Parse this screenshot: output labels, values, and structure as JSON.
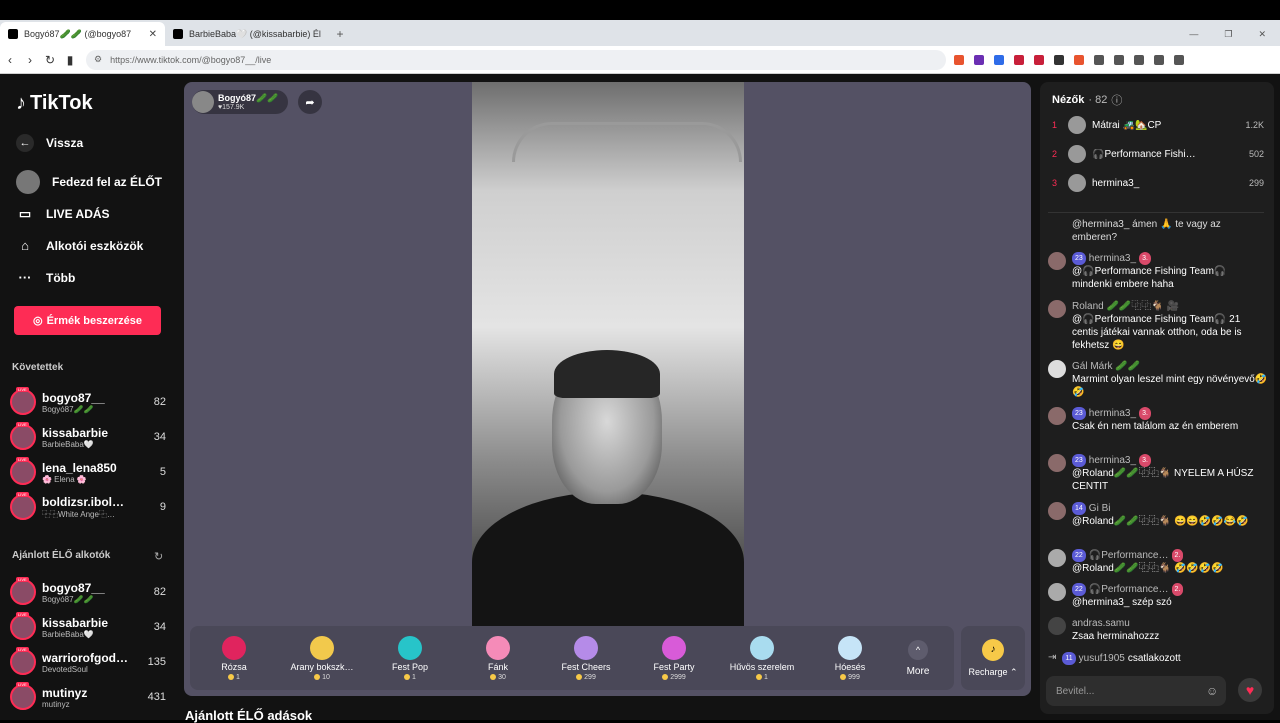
{
  "browser": {
    "tabs": [
      {
        "title": "Bogyó87🥒🥒 (@bogyo87",
        "close": "✕"
      },
      {
        "title": "BarbieBaba🤍 (@kissabarbie) Él…",
        "close": ""
      }
    ],
    "new_tab": "+",
    "url": "https://www.tiktok.com/@bogyo87__/live"
  },
  "sidebar": {
    "logo": "TikTok",
    "nav": [
      {
        "label": "Vissza",
        "icon": "back-arrow-icon"
      },
      {
        "label": "Fedezd fel az ÉLŐT",
        "icon": "avatar"
      },
      {
        "label": "LIVE ADÁS",
        "icon": "video-camera-icon"
      },
      {
        "label": "Alkotói eszközök",
        "icon": "house-icon"
      },
      {
        "label": "Több",
        "icon": "ellipsis-icon"
      }
    ],
    "coins_button": "Érmék beszerzése",
    "following_title": "Követettek",
    "following": [
      {
        "name": "bogyo87__",
        "sub": "Bogyó87🥒🥒",
        "count": "82"
      },
      {
        "name": "kissabarbie",
        "sub": "BarbieBaba🤍",
        "count": "34"
      },
      {
        "name": "lena_lena850",
        "sub": "🌸 Elena 🌸",
        "count": "5"
      },
      {
        "name": "boldizsr.ibol…",
        "sub": "⿻⿻White Ange⿻…",
        "count": "9"
      }
    ],
    "suggested_title": "Ajánlott ÉLŐ alkotók",
    "suggested": [
      {
        "name": "bogyo87__",
        "sub": "Bogyó87🥒🥒",
        "count": "82"
      },
      {
        "name": "kissabarbie",
        "sub": "BarbieBaba🤍",
        "count": "34"
      },
      {
        "name": "warriorofgod…",
        "sub": "DevotedSoul",
        "count": "135"
      },
      {
        "name": "mutinyz",
        "sub": "mutinyz",
        "count": "431"
      }
    ]
  },
  "stream": {
    "host_name": "Bogyó87🥒🥒",
    "host_likes": "♥157.9K",
    "gifts": [
      {
        "name": "Rózsa",
        "price": "1",
        "color": "#e0245e"
      },
      {
        "name": "Arany bokszk…",
        "price": "10",
        "color": "#f2c94c"
      },
      {
        "name": "Fest Pop",
        "price": "1",
        "color": "#27c4c9"
      },
      {
        "name": "Fánk",
        "price": "30",
        "color": "#f58bb8"
      },
      {
        "name": "Fest Cheers",
        "price": "299",
        "color": "#b58be8"
      },
      {
        "name": "Fest Party",
        "price": "2999",
        "color": "#d85bd8"
      },
      {
        "name": "Hűvös szerelem",
        "price": "1",
        "color": "#a9dcef"
      },
      {
        "name": "Hóesés",
        "price": "999",
        "color": "#c6e4f7"
      }
    ],
    "more_label": "More",
    "recharge_label": "Recharge ⌃"
  },
  "bottom_title": "Ajánlott ÉLŐ adások",
  "chat": {
    "viewers_label": "Nézők",
    "viewers_count": "· 82",
    "top_viewers": [
      {
        "rank": "1",
        "name": "Mátrai 🚜🏡CP",
        "score": "1.2K"
      },
      {
        "rank": "2",
        "name": "🎧Performance Fishi…",
        "score": "502"
      },
      {
        "rank": "3",
        "name": "hermina3_",
        "score": "299"
      }
    ],
    "messages": [
      {
        "user": "",
        "badges": [],
        "text": "@hermina3_ ámen 🙏 te vagy az emberen?"
      },
      {
        "user": "hermina3_",
        "badges": [
          "23",
          "3."
        ],
        "text": "@🎧Performance Fishing Team🎧 mindenki embere haha"
      },
      {
        "user": "Roland 🥒🥒⿻⿻🐐 🎥",
        "badges": [],
        "text": "@🎧Performance Fishing Team🎧 21 centis játékai vannak otthon, oda be is fekhetsz 😄"
      },
      {
        "user": "Gál Márk 🥒🥒",
        "badges": [],
        "text": "Marmint olyan leszel mint egy növényevő🤣🤣"
      },
      {
        "user": "hermina3_",
        "badges": [
          "23",
          "3."
        ],
        "text": "Csak én nem találom az én emberem"
      },
      {
        "user": "hermina3_",
        "badges": [
          "23",
          "3."
        ],
        "text": "@Roland🥒🥒⿻⿻🐐 NYELEM A HÚSZ CENTIT"
      },
      {
        "user": "Gi Bi",
        "badges": [
          "14"
        ],
        "text": "@Roland🥒🥒⿻⿻🐐 😄😄🤣🤣😂🤣"
      },
      {
        "user": "🎧Performance…",
        "badges": [
          "22",
          "2."
        ],
        "text": "@Roland🥒🥒⿻⿻🐐 🤣🤣🤣🤣"
      },
      {
        "user": "🎧Performance…",
        "badges": [
          "22",
          "2."
        ],
        "text": "@hermina3_ szép szó"
      },
      {
        "user": "andras.samu",
        "badges": [],
        "text": "Zsaa herminahozzz"
      },
      {
        "user": "yusuf1905",
        "badges": [
          "11"
        ],
        "text": "csatlakozott"
      }
    ],
    "input_placeholder": "Bevitel..."
  }
}
